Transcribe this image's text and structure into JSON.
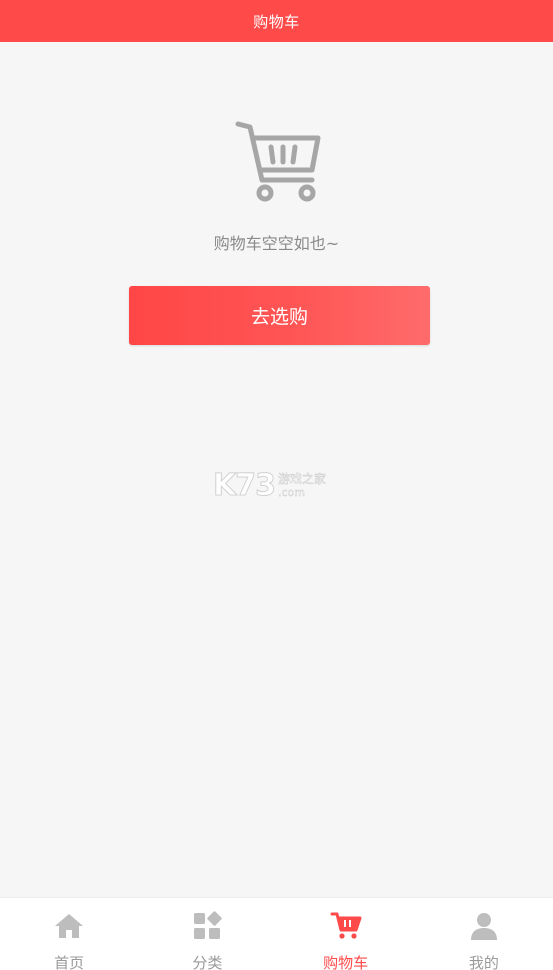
{
  "header": {
    "title": "购物车"
  },
  "empty_state": {
    "icon": "empty-cart-icon",
    "message": "购物车空空如也~",
    "button_label": "去选购"
  },
  "watermark": {
    "logo": "K73",
    "name": "游戏之家",
    "domain": ".com"
  },
  "tabbar": {
    "items": [
      {
        "label": "首页",
        "icon": "home-icon",
        "active": false
      },
      {
        "label": "分类",
        "icon": "category-icon",
        "active": false
      },
      {
        "label": "购物车",
        "icon": "cart-icon",
        "active": true
      },
      {
        "label": "我的",
        "icon": "user-icon",
        "active": false
      }
    ]
  },
  "colors": {
    "brand_red": "#ff4a4a",
    "inactive_gray": "#9a9a9a",
    "background": "#f6f6f6"
  }
}
